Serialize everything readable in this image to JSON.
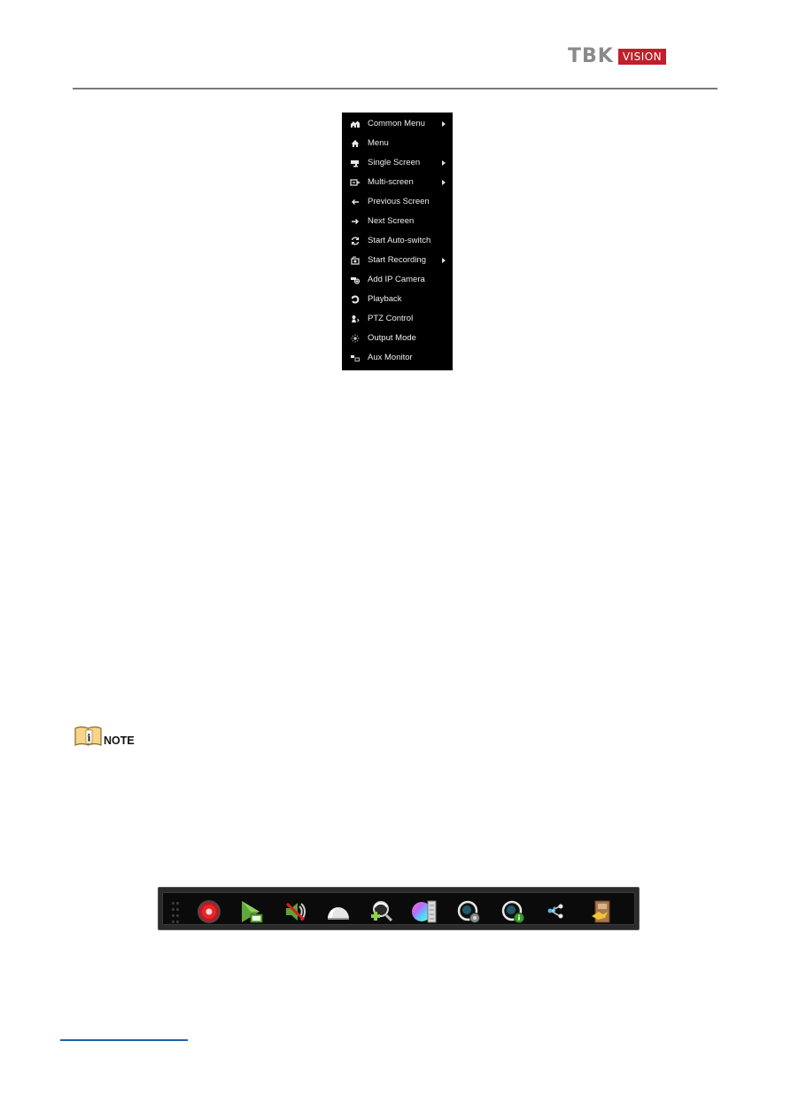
{
  "header": {
    "logo_brand": "TBK",
    "logo_sub": "VISION",
    "brand_color": "#c0202a",
    "brand_gray": "#8a8a8a"
  },
  "context_menu": {
    "items": [
      {
        "label": "Common Menu",
        "icon": "common-menu-icon",
        "submenu": true
      },
      {
        "label": "Menu",
        "icon": "home-icon",
        "submenu": false
      },
      {
        "label": "Single Screen",
        "icon": "camera-icon",
        "submenu": true
      },
      {
        "label": "Multi-screen",
        "icon": "multi-screen-icon",
        "submenu": true
      },
      {
        "label": "Previous Screen",
        "icon": "arrow-left-icon",
        "submenu": false
      },
      {
        "label": "Next Screen",
        "icon": "arrow-right-icon",
        "submenu": false
      },
      {
        "label": "Start Auto-switch",
        "icon": "refresh-icon",
        "submenu": false
      },
      {
        "label": "Start Recording",
        "icon": "record-icon",
        "submenu": true
      },
      {
        "label": "Add IP Camera",
        "icon": "add-camera-icon",
        "submenu": false
      },
      {
        "label": "Playback",
        "icon": "playback-icon",
        "submenu": false
      },
      {
        "label": "PTZ Control",
        "icon": "ptz-icon",
        "submenu": false
      },
      {
        "label": "Output Mode",
        "icon": "output-mode-icon",
        "submenu": false
      },
      {
        "label": "Aux Monitor",
        "icon": "aux-monitor-icon",
        "submenu": false
      }
    ]
  },
  "note": {
    "label": "NOTE",
    "icon": "info-book-icon"
  },
  "toolbar": {
    "buttons": [
      {
        "name": "manual-record",
        "icon": "record-button-icon"
      },
      {
        "name": "instant-playback",
        "icon": "instant-playback-icon"
      },
      {
        "name": "mute-audio",
        "icon": "mute-audio-icon"
      },
      {
        "name": "ptz-control",
        "icon": "ptz-dome-icon"
      },
      {
        "name": "digital-zoom",
        "icon": "digital-zoom-icon"
      },
      {
        "name": "image-settings",
        "icon": "image-settings-icon"
      },
      {
        "name": "live-view-strategy",
        "icon": "live-strategy-icon"
      },
      {
        "name": "info",
        "icon": "camera-info-icon"
      },
      {
        "name": "stream-switch",
        "icon": "stream-share-icon"
      },
      {
        "name": "close-toolbar",
        "icon": "exit-door-icon"
      }
    ]
  }
}
